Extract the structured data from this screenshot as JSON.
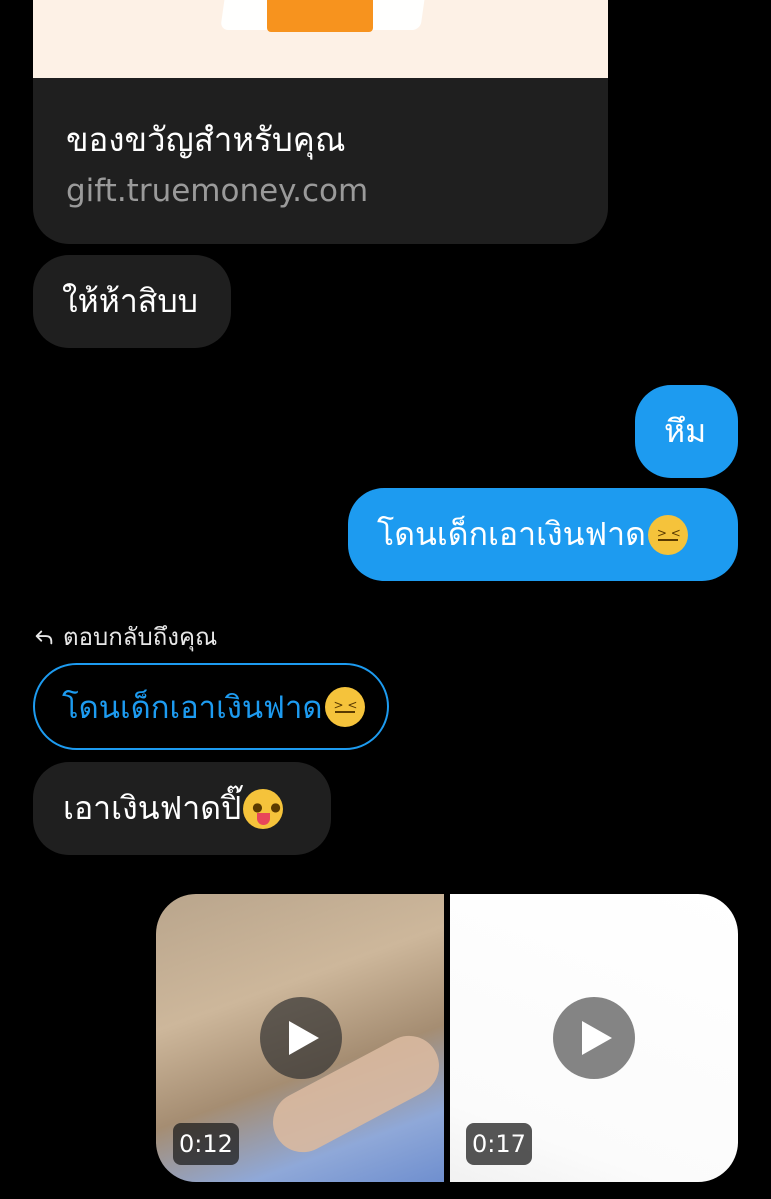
{
  "link_preview": {
    "title": "ของขวัญสำหรับคุณ",
    "domain": "gift.truemoney.com"
  },
  "messages": [
    {
      "direction": "incoming",
      "text": "ให้ห้าสิบบ"
    },
    {
      "direction": "outgoing",
      "text": "หึม"
    },
    {
      "direction": "outgoing",
      "text": "โดนเด็กเอาเงินฟาด",
      "emoji": "confounded-face"
    }
  ],
  "reply": {
    "label": "ตอบกลับถึงคุณ",
    "quoted_text": "โดนเด็กเอาเงินฟาด",
    "quoted_emoji": "confounded-face",
    "text": "เอาเงินฟาดปิ๊",
    "emoji": "tongue-face"
  },
  "media": [
    {
      "type": "video",
      "duration": "0:12"
    },
    {
      "type": "video",
      "duration": "0:17"
    }
  ],
  "colors": {
    "background": "#000000",
    "incoming_bubble": "#1f1f1f",
    "outgoing_bubble": "#1d9bf0",
    "accent": "#1d9bf0",
    "secondary_text": "#9a9a9a"
  }
}
